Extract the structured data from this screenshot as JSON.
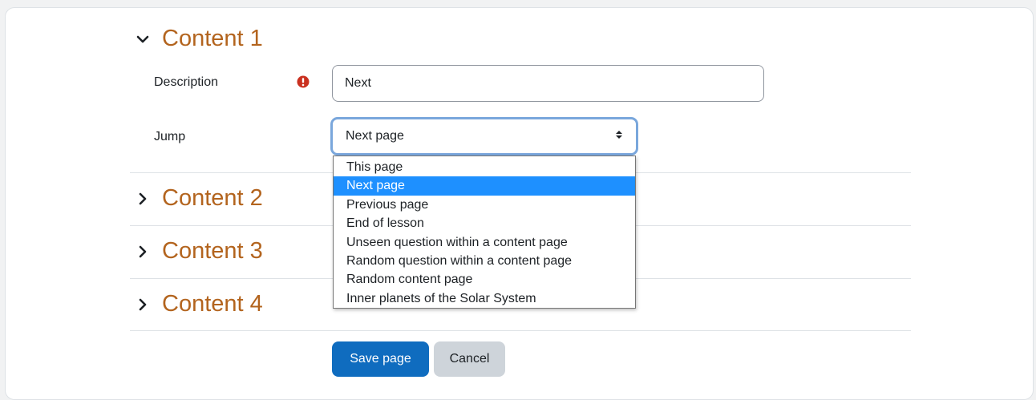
{
  "sections": [
    {
      "title": "Content 1",
      "expanded": true
    },
    {
      "title": "Content 2",
      "expanded": false
    },
    {
      "title": "Content 3",
      "expanded": false
    },
    {
      "title": "Content 4",
      "expanded": false
    }
  ],
  "form": {
    "description_label": "Description",
    "description_value": "Next",
    "jump_label": "Jump",
    "jump_selected": "Next page",
    "jump_options": [
      "This page",
      "Next page",
      "Previous page",
      "End of lesson",
      "Unseen question within a content page",
      "Random question within a content page",
      "Random content page",
      "Inner planets of the Solar System"
    ],
    "jump_highlighted_index": 1
  },
  "buttons": {
    "save_label": "Save page",
    "cancel_label": "Cancel"
  },
  "colors": {
    "section_title": "#b3641e",
    "primary": "#0f6cbf",
    "required": "#ca3120",
    "option_highlight": "#1e90ff",
    "focus_ring": "#7aa7dc"
  },
  "icons": {
    "expanded": "chevron-down-icon",
    "collapsed": "chevron-right-icon",
    "required": "exclamation-circle-icon",
    "select_arrows": "sort-arrows-icon"
  }
}
